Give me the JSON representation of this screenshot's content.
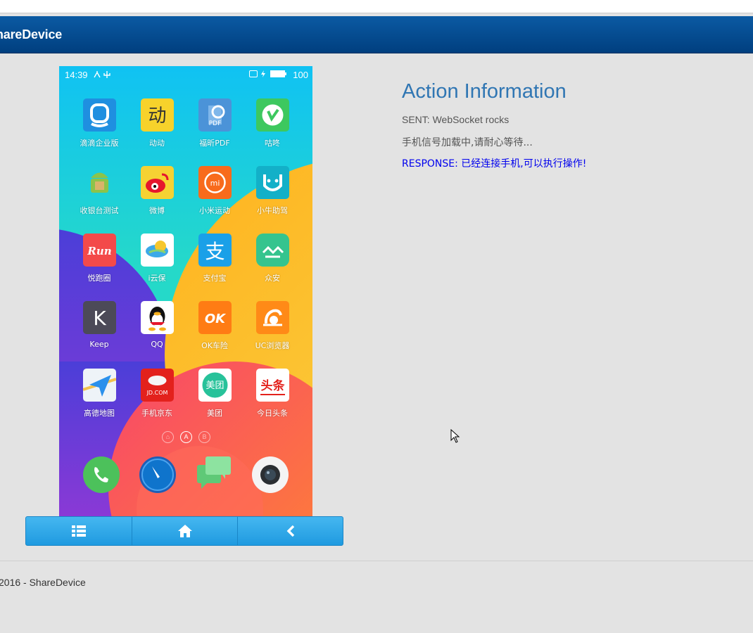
{
  "brand": {
    "title": "hareDevice"
  },
  "phone": {
    "status": {
      "time": "14:39",
      "battery": "100"
    },
    "apps": [
      {
        "label": "滴滴企业版",
        "icon": "didi-icon",
        "glyph": ""
      },
      {
        "label": "动动",
        "icon": "dongdong-icon",
        "glyph": "动"
      },
      {
        "label": "福昕PDF",
        "icon": "foxit-pdf-icon",
        "glyph": "PDF"
      },
      {
        "label": "咕咚",
        "icon": "codoon-icon",
        "glyph": ""
      },
      {
        "label": "收银台测试",
        "icon": "android-icon",
        "glyph": ""
      },
      {
        "label": "微博",
        "icon": "weibo-icon",
        "glyph": ""
      },
      {
        "label": "小米运动",
        "icon": "mi-fit-icon",
        "glyph": "mi"
      },
      {
        "label": "小牛助驾",
        "icon": "xiaoniu-icon",
        "glyph": ""
      },
      {
        "label": "悦跑圈",
        "icon": "joyrun-icon",
        "glyph": "Run"
      },
      {
        "label": "i云保",
        "icon": "icloud-bao-icon",
        "glyph": ""
      },
      {
        "label": "支付宝",
        "icon": "alipay-icon",
        "glyph": "支"
      },
      {
        "label": "众安",
        "icon": "zhongan-icon",
        "glyph": ""
      },
      {
        "label": "Keep",
        "icon": "keep-icon",
        "glyph": "K"
      },
      {
        "label": "QQ",
        "icon": "qq-icon",
        "glyph": ""
      },
      {
        "label": "OK车险",
        "icon": "ok-insurance-icon",
        "glyph": "OK"
      },
      {
        "label": "UC浏览器",
        "icon": "uc-browser-icon",
        "glyph": ""
      },
      {
        "label": "高德地图",
        "icon": "amap-icon",
        "glyph": ""
      },
      {
        "label": "手机京东",
        "icon": "jd-icon",
        "glyph": "JD.COM"
      },
      {
        "label": "美团",
        "icon": "meituan-icon",
        "glyph": "美团"
      },
      {
        "label": "今日头条",
        "icon": "toutiao-icon",
        "glyph": "头条"
      }
    ],
    "page_dots": [
      "⌂",
      "A",
      "B"
    ],
    "dock": [
      "phone-icon",
      "compass-icon",
      "messages-icon",
      "camera-icon"
    ]
  },
  "controls": {
    "menu_icon": "list-icon",
    "home_icon": "home-icon",
    "back_icon": "chevron-left-icon"
  },
  "info": {
    "title": "Action Information",
    "sent": "SENT: WebSocket rocks",
    "loading": "手机信号加载中,请耐心等待...",
    "response": "RESPONSE: 已经连接手机,可以执行操作!"
  },
  "footer": {
    "text": "2016 - ShareDevice"
  },
  "colors": {
    "navbar": "#0b5aa3",
    "title": "#3076b3",
    "response": "#0000ee",
    "button": "#2aa4e8"
  }
}
